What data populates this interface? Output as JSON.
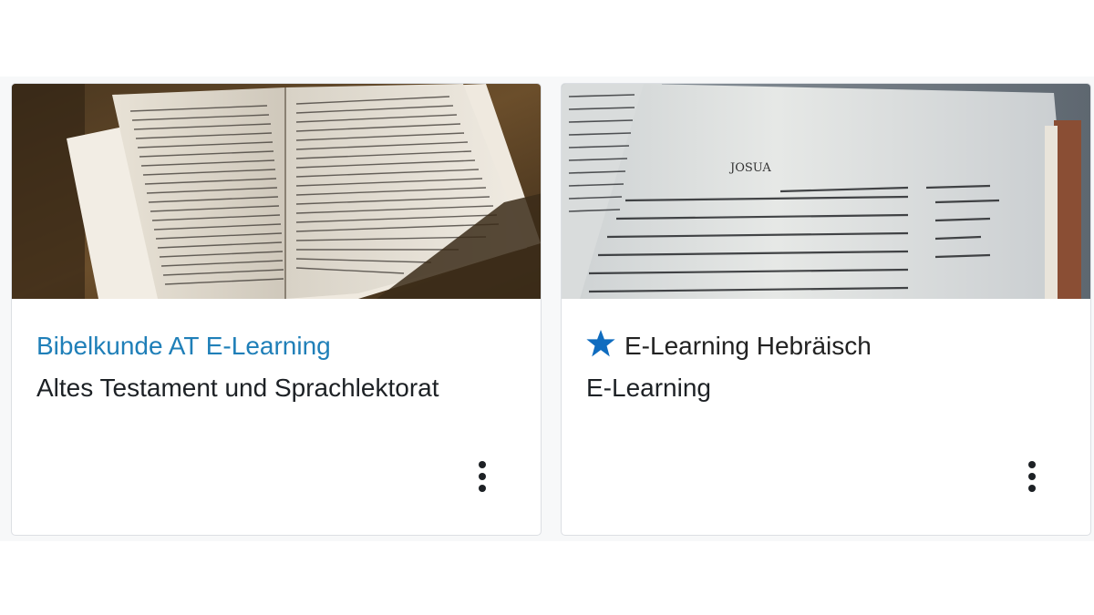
{
  "courses": [
    {
      "image_icon": "open-bible-photo",
      "title": "Bibelkunde AT E-Learning",
      "category": "Altes Testament und Sprachlektorat",
      "starred": false,
      "title_color": "#1f7fb8",
      "menu_icon": "kebab-menu-icon"
    },
    {
      "image_icon": "hebrew-bible-photo",
      "image_heading": "JOSUA",
      "title": "E-Learning Hebräisch",
      "category": "E-Learning",
      "starred": true,
      "star_color": "#0f6cbf",
      "menu_icon": "kebab-menu-icon"
    }
  ]
}
